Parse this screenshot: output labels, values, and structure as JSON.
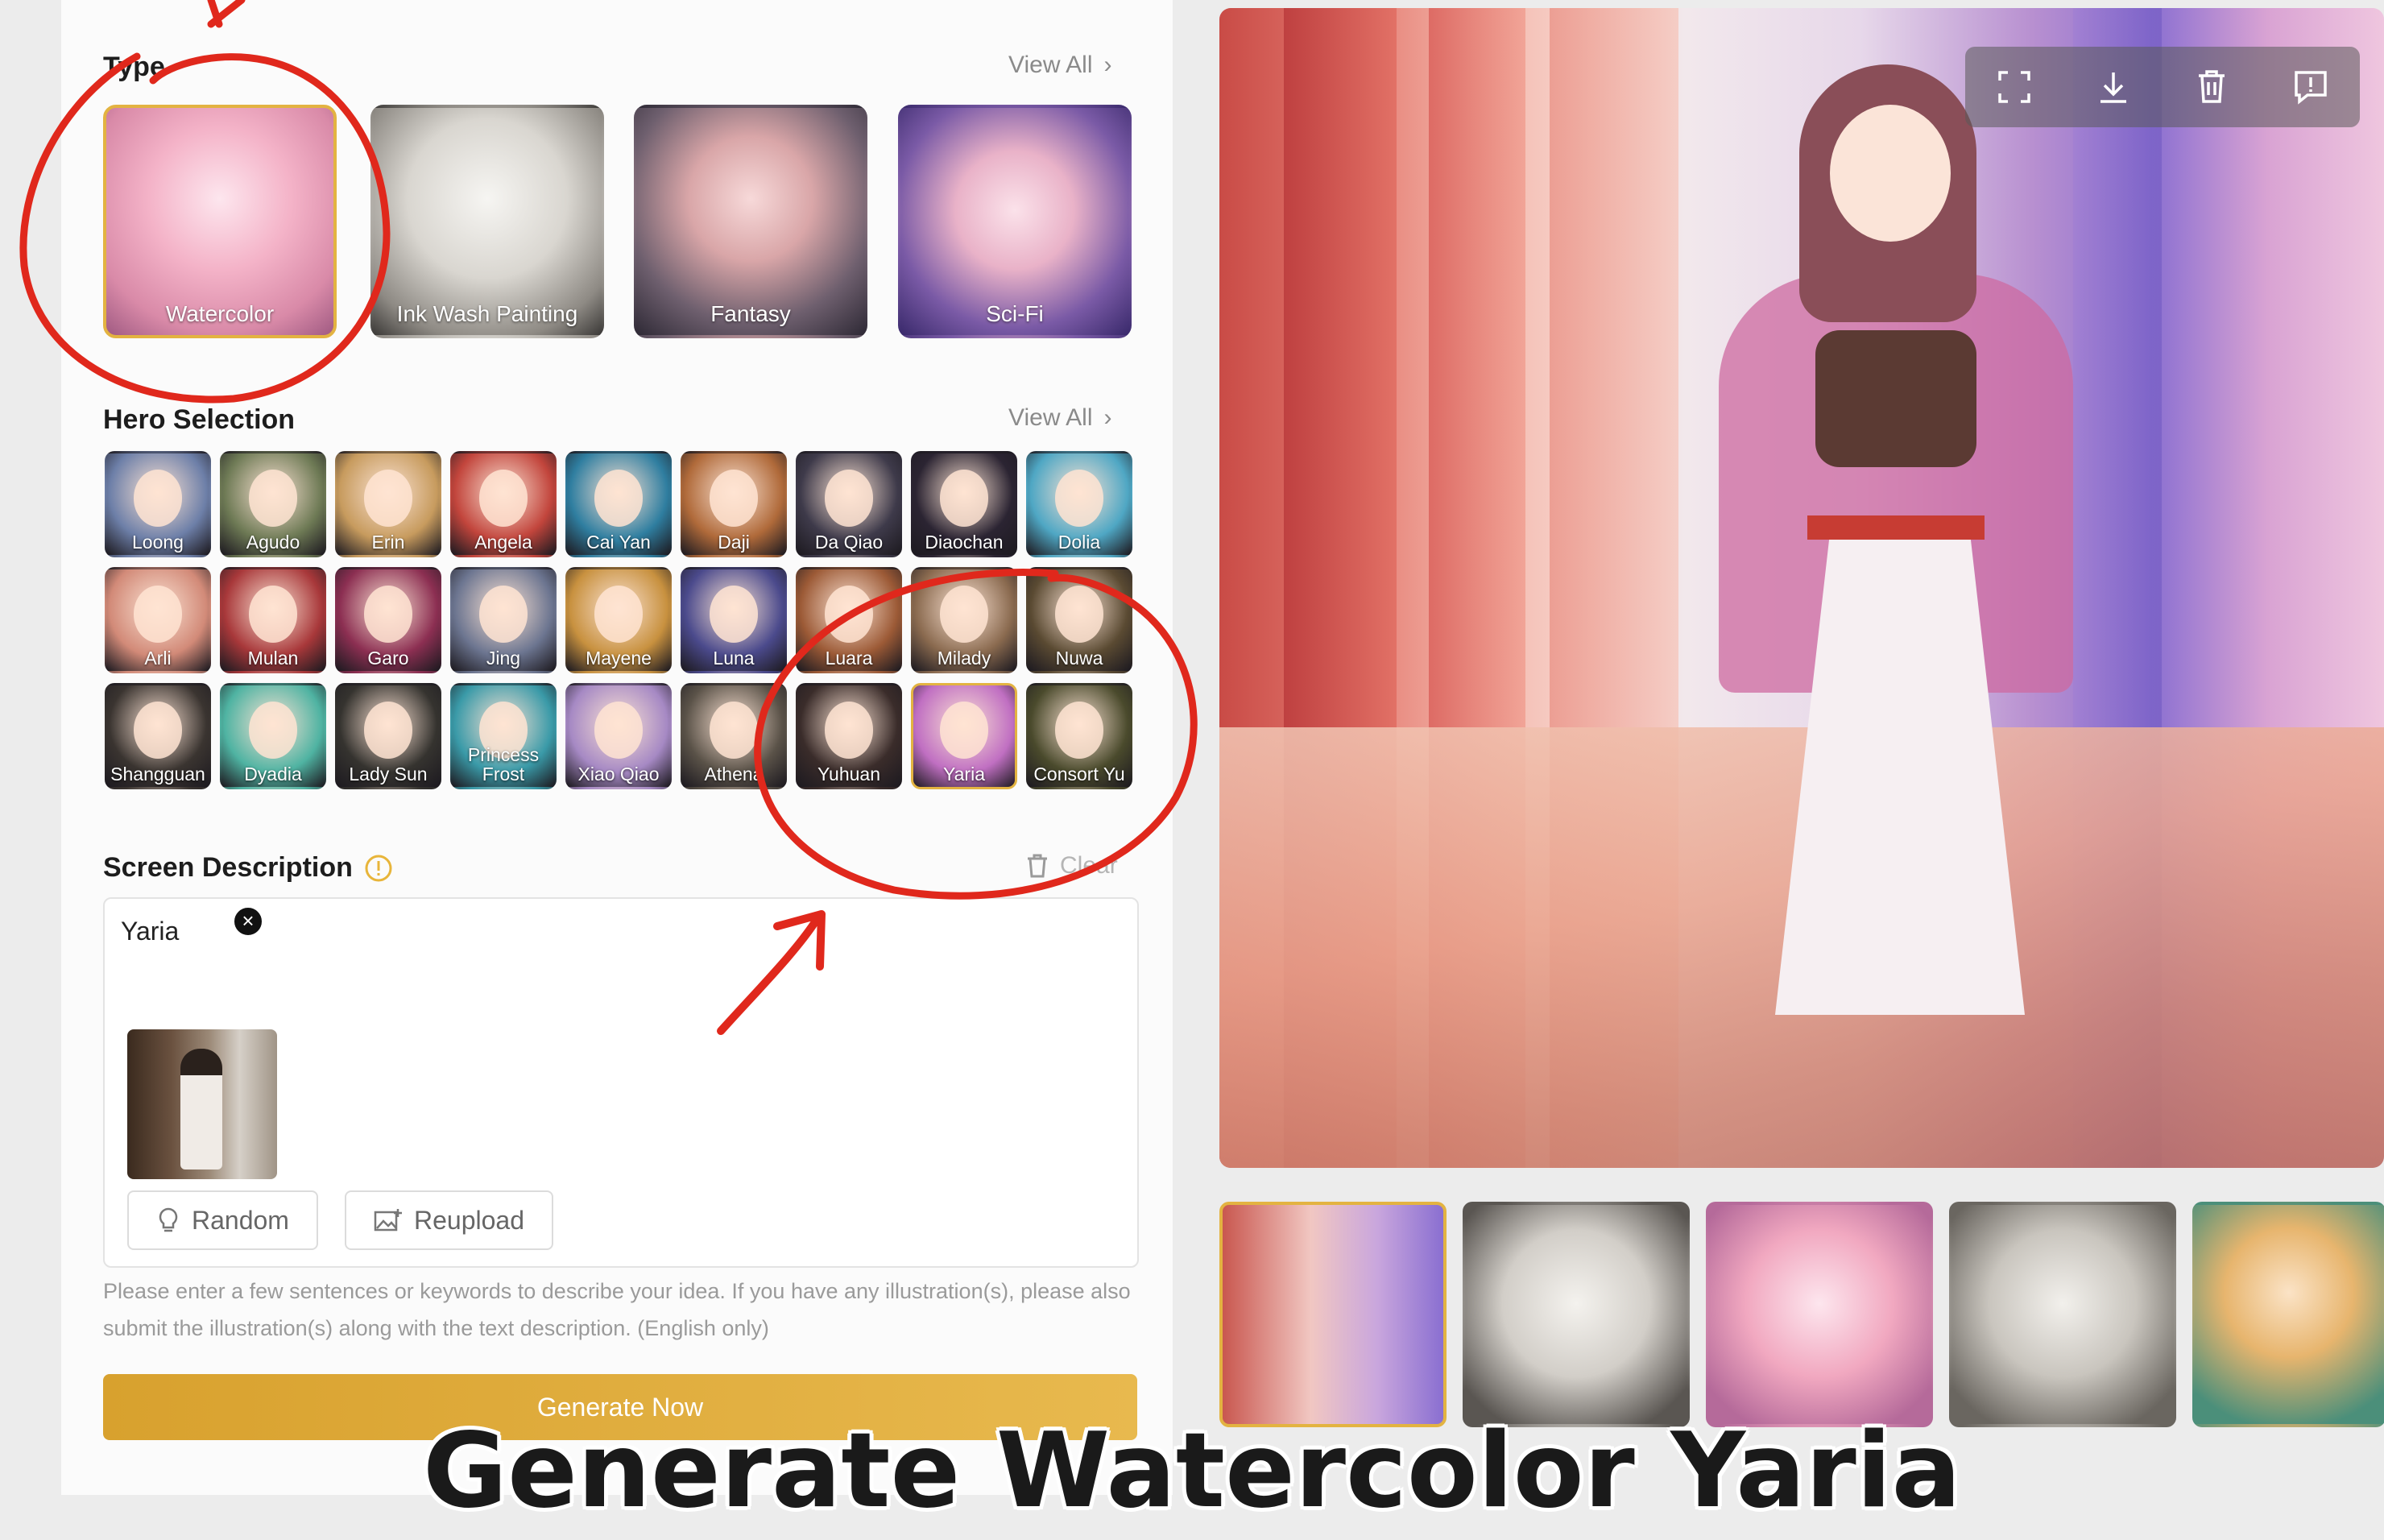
{
  "type_section": {
    "title": "Type",
    "view_all": "View All",
    "styles": [
      {
        "label": "Watercolor",
        "selected": true
      },
      {
        "label": "Ink Wash Painting",
        "selected": false
      },
      {
        "label": "Fantasy",
        "selected": false
      },
      {
        "label": "Sci-Fi",
        "selected": false
      }
    ]
  },
  "hero_section": {
    "title": "Hero Selection",
    "view_all": "View All",
    "heroes": [
      {
        "name": "Loong",
        "color": "#6d7fa8"
      },
      {
        "name": "Agudo",
        "color": "#6e7a55"
      },
      {
        "name": "Erin",
        "color": "#c79b5e"
      },
      {
        "name": "Angela",
        "color": "#c2453c"
      },
      {
        "name": "Cai Yan",
        "color": "#2f7ea0"
      },
      {
        "name": "Daji",
        "color": "#b06a3a"
      },
      {
        "name": "Da Qiao",
        "color": "#3e3a4a"
      },
      {
        "name": "Diaochan",
        "color": "#2b2432"
      },
      {
        "name": "Dolia",
        "color": "#4fa7c4"
      },
      {
        "name": "Arli",
        "color": "#d28a78"
      },
      {
        "name": "Mulan",
        "color": "#a8383a"
      },
      {
        "name": "Garo",
        "color": "#8c2f52"
      },
      {
        "name": "Jing",
        "color": "#6c7590"
      },
      {
        "name": "Mayene",
        "color": "#c8913f"
      },
      {
        "name": "Luna",
        "color": "#4b4a8c"
      },
      {
        "name": "Luara",
        "color": "#9c5a36"
      },
      {
        "name": "Milady",
        "color": "#8a6a4f"
      },
      {
        "name": "Nuwa",
        "color": "#5a4a32"
      },
      {
        "name": "Shangguan",
        "color": "#3a3430"
      },
      {
        "name": "Dyadia",
        "color": "#4fb3a2"
      },
      {
        "name": "Lady Sun",
        "color": "#35332f"
      },
      {
        "name": "Princess Frost",
        "color": "#3a9aa8"
      },
      {
        "name": "Xiao Qiao",
        "color": "#a689c4"
      },
      {
        "name": "Athena",
        "color": "#5a5248"
      },
      {
        "name": "Yuhuan",
        "color": "#3a2c2a"
      },
      {
        "name": "Yaria",
        "color": "#c06fc2",
        "selected": true
      },
      {
        "name": "Consort Yu",
        "color": "#4a4a2c"
      }
    ]
  },
  "description": {
    "title": "Screen Description",
    "clear_label": "Clear",
    "text": "Yaria",
    "random_label": "Random",
    "reupload_label": "Reupload",
    "hint": "Please enter a few sentences or keywords to describe your idea. If you have any illustration(s), please also submit the illustration(s) along with the text description. (English only)"
  },
  "generate_button": "Generate Now",
  "preview": {
    "toolbar": [
      "fullscreen-icon",
      "download-icon",
      "trash-icon",
      "feedback-icon"
    ]
  },
  "gallery": [
    {
      "name": "gallery-watercolor",
      "selected": true
    },
    {
      "name": "gallery-ink-girl",
      "selected": false
    },
    {
      "name": "gallery-pink-girl",
      "selected": false
    },
    {
      "name": "gallery-ink-sketch",
      "selected": false
    },
    {
      "name": "gallery-blonde-girl",
      "selected": false
    }
  ],
  "caption": "Generate Watercolor Yaria",
  "colors": {
    "accent": "#e3b341",
    "annotation": "#e0281c"
  }
}
